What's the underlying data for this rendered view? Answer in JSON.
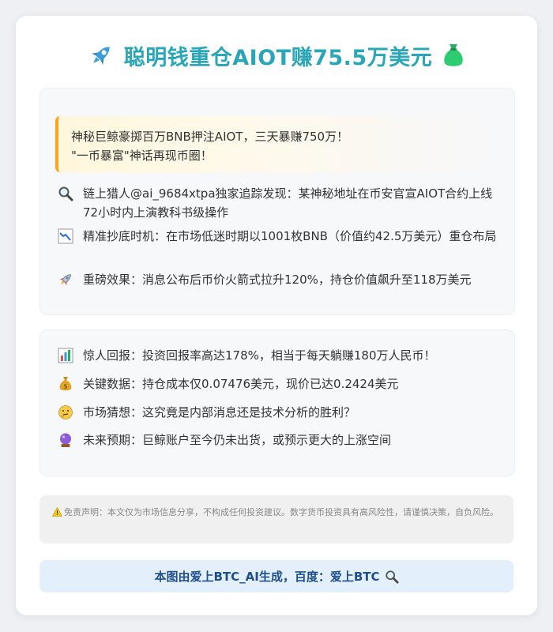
{
  "header": {
    "title": "聪明钱重仓AIOT赚75.5万美元",
    "left_icon": "rocket-icon",
    "right_icon": "money-bag-icon"
  },
  "highlight": {
    "line1": "神秘巨鲸豪掷百万BNB押注AIOT，三天暴赚750万！",
    "line2": "\"一币暴富\"神话再现币圈！"
  },
  "details": [
    {
      "icon": "magnifier-icon",
      "text": "链上猎人@ai_9684xtpa独家追踪发现：某神秘地址在币安官宣AIOT合约上线72小时内上演教科书级操作"
    },
    {
      "icon": "chart-down-icon",
      "text": "精准抄底时机：在市场低迷时期以1001枚BNB（价值约42.5万美元）重仓布局"
    },
    {
      "icon": "rocket-icon",
      "text": "重磅效果：消息公布后币价火箭式拉升120%，持仓价值飙升至118万美元"
    }
  ],
  "insights": [
    {
      "icon": "bar-chart-icon",
      "text": "惊人回报：投资回报率高达178%，相当于每天躺赚180万人民币！"
    },
    {
      "icon": "money-bag-icon",
      "text": "关键数据：持仓成本仅0.07476美元，现价已达0.2424美元"
    },
    {
      "icon": "thinking-face-icon",
      "text": "市场猜想：这究竟是内部消息还是技术分析的胜利？"
    },
    {
      "icon": "crystal-ball-icon",
      "text": "未来预期：巨鲸账户至今仍未出货，或预示更大的上涨空间"
    }
  ],
  "disclaimer": {
    "icon": "warning-icon",
    "text": "免责声明：本文仅为市场信息分享，不构成任何投资建议。数字货币投资具有高风险性，请谨慎决策，自负风险。"
  },
  "footer": {
    "text": "本图由爱上BTC_AI生成，百度：爱上BTC",
    "icon": "magnifier-icon"
  },
  "colors": {
    "title": "#2aa6b9",
    "accent_border": "#f5a623",
    "footer_text": "#1f4e8c",
    "footer_bg": "#e3f0fb"
  }
}
